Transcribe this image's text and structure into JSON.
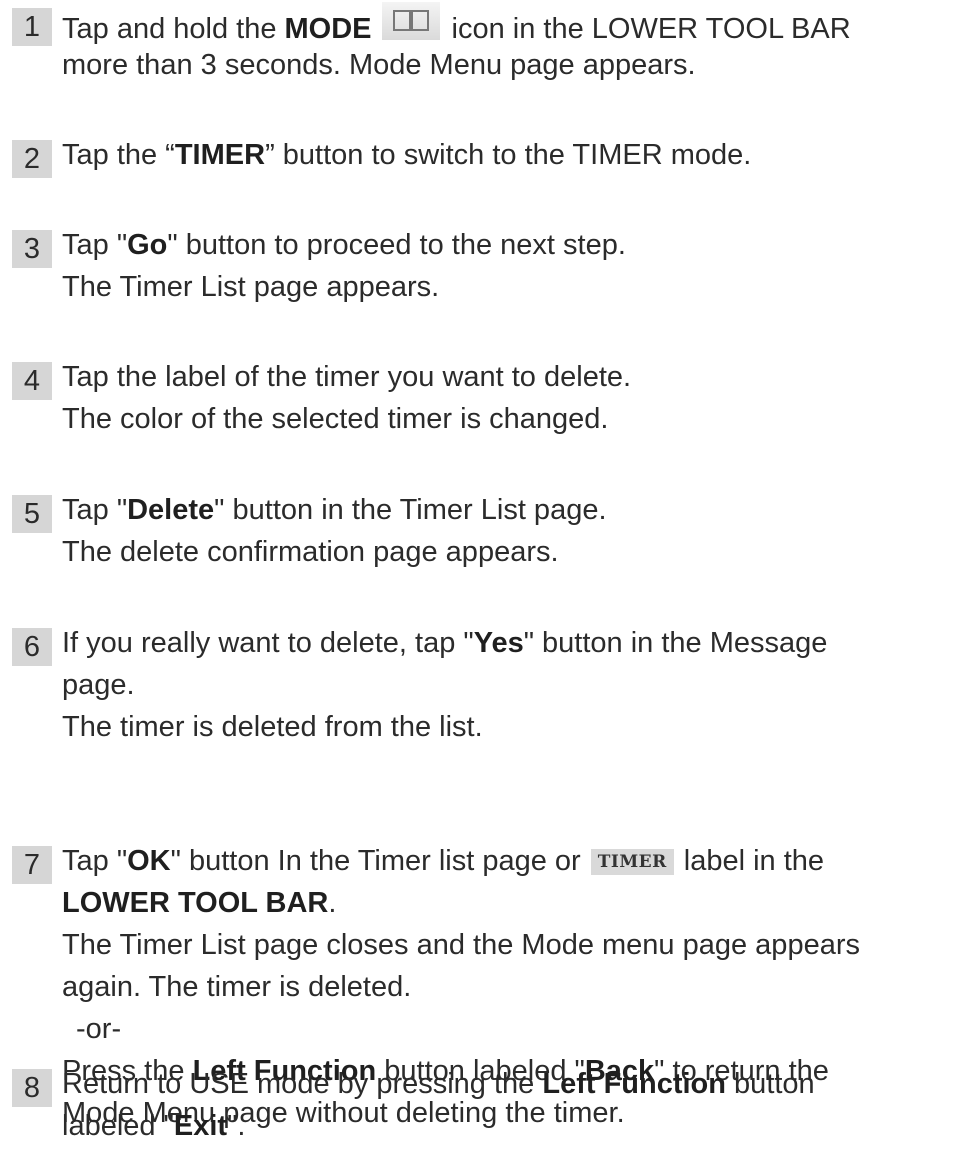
{
  "steps": [
    {
      "number": "1",
      "lines": [
        [
          "Tap and hold the ",
          {
            "b": "MODE"
          },
          {
            "icon": "mode-book-icon"
          },
          "icon in the LOWER TOOL BAR"
        ],
        [
          "more than 3 seconds. Mode Menu page appears."
        ]
      ]
    },
    {
      "number": "2",
      "lines": [
        [
          "Tap the “",
          {
            "b": "TIMER"
          },
          "” button to switch to the TIMER mode."
        ]
      ]
    },
    {
      "number": "3",
      "lines": [
        [
          "Tap \"",
          {
            "b": "Go"
          },
          "\" button to proceed to the next step."
        ],
        [
          "The Timer List page appears."
        ]
      ]
    },
    {
      "number": "4",
      "lines": [
        [
          "Tap the label of the timer you want to delete."
        ],
        [
          "The color of the selected timer is changed."
        ]
      ]
    },
    {
      "number": "5",
      "lines": [
        [
          "Tap \"",
          {
            "b": "Delete"
          },
          "\" button in the Timer List page."
        ],
        [
          "The delete confirmation page appears."
        ]
      ]
    },
    {
      "number": "6",
      "lines": [
        [
          "If you really want to delete, tap \"",
          {
            "b": "Yes"
          },
          "\" button in the Message"
        ],
        [
          "page."
        ],
        [
          "The timer is deleted from the list."
        ]
      ]
    },
    {
      "number": "7",
      "lines": [
        [
          "Tap \"",
          {
            "b": "OK"
          },
          "\" button In the Timer list page or ",
          {
            "label": "TIMER"
          },
          "label in the"
        ],
        [
          {
            "b": "LOWER TOOL BAR"
          },
          "."
        ],
        [
          "The Timer List page closes and the Mode menu page appears"
        ],
        [
          "again. The timer is deleted."
        ],
        [
          {
            "or": "-or-"
          }
        ],
        [
          "Press the ",
          {
            "b": "Left Function"
          },
          " button labeled \"",
          {
            "b": "Back"
          },
          "\" to return the"
        ],
        [
          "Mode Menu page without deleting the timer."
        ]
      ]
    },
    {
      "number": "8",
      "lines": [
        [
          "Return to USE mode by pressing the ",
          {
            "b": "Left Function"
          },
          " button"
        ],
        [
          "labeled \"",
          {
            "b": "Exit"
          },
          "\"."
        ]
      ]
    }
  ]
}
